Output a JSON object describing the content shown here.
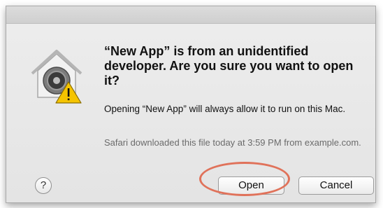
{
  "dialog": {
    "headline": "“New App” is from an unidentified developer. Are you sure you want to open it?",
    "info": "Opening “New App” will always allow it to run on this Mac.",
    "source": "Safari downloaded this file today at 3:59 PM from example.com.",
    "icon": "gatekeeper-house-lock-warning-icon"
  },
  "buttons": {
    "help_label": "?",
    "open_label": "Open",
    "cancel_label": "Cancel"
  },
  "colors": {
    "highlight_ring": "#e0725a",
    "warning_yellow": "#f5c400"
  }
}
